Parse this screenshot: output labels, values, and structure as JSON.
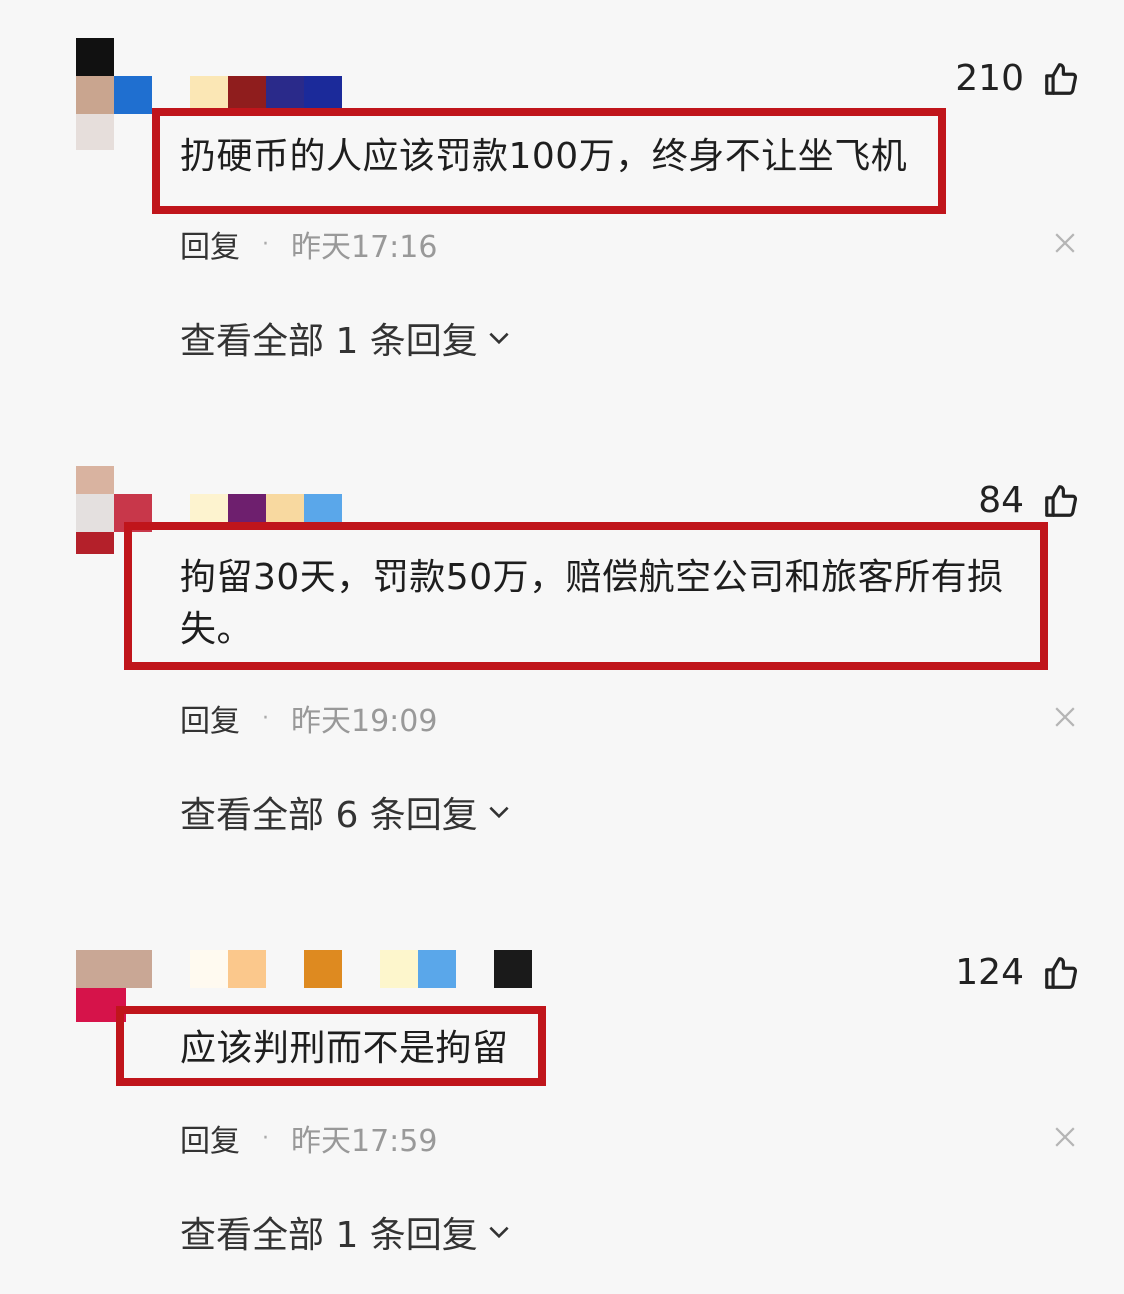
{
  "comments": [
    {
      "likes": "210",
      "text": "扔硬币的人应该罚款100万，终身不让坐飞机",
      "reply_label": "回复",
      "separator": "·",
      "time": "昨天17:16",
      "expand_label": "查看全部 1 条回复"
    },
    {
      "likes": "84",
      "text": "拘留30天，罚款50万，赔偿航空公司和旅客所有损失。",
      "reply_label": "回复",
      "separator": "·",
      "time": "昨天19:09",
      "expand_label": "查看全部 6 条回复"
    },
    {
      "likes": "124",
      "text": "应该判刑而不是拘留",
      "reply_label": "回复",
      "separator": "·",
      "time": "昨天17:59",
      "expand_label": "查看全部 1 条回复"
    }
  ],
  "icons": {
    "like": "thumbs-up-icon",
    "close": "close-icon",
    "expand": "chevron-down-icon"
  },
  "colors": {
    "highlight_box": "#c0151b",
    "time_text": "#999999",
    "background": "#f7f7f7"
  }
}
